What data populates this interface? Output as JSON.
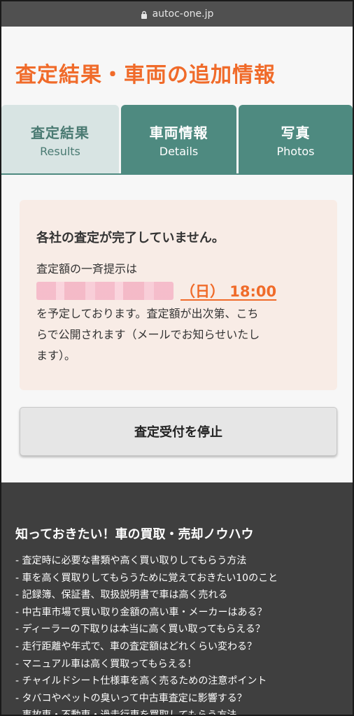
{
  "browser": {
    "url": "autoc-one.jp"
  },
  "page": {
    "title": "査定結果・車両の追加情報"
  },
  "tabs": [
    {
      "jp": "査定結果",
      "en": "Results"
    },
    {
      "jp": "車両情報",
      "en": "Details"
    },
    {
      "jp": "写真",
      "en": "Photos"
    }
  ],
  "notice": {
    "heading": "各社の査定が完了していません。",
    "line1": "査定額の一斉提示は",
    "date_suffix": "（日） 18:00",
    "line2": "を予定しております。査定額が出次第、こち",
    "line3": "らで公開されます（メールでお知らせいたし",
    "line4": "ます）。"
  },
  "stop_button": "査定受付を停止",
  "footer": {
    "title": "知っておきたい！車の買取・売却ノウハウ",
    "links": [
      "- 査定時に必要な書類や高く買い取りしてもらう方法",
      "- 車を高く買取りしてもらうために覚えておきたい10のこと",
      "- 記録簿、保証書、取扱説明書で車は高く売れる",
      "- 中古車市場で買い取り金額の高い車・メーカーはある？",
      "- ディーラーの下取りは本当に高く買い取ってもらえる？",
      "- 走行距離や年式で、車の査定額はどれくらい変わる？",
      "- マニュアル車は高く買取ってもらえる！",
      "- チャイルドシート仕様車を高く売るための注意ポイント",
      "- タバコやペットの臭いって中古車査定に影響する？",
      "- 事故車・不動車・過走行車を買取してもらう方法"
    ]
  },
  "colors": {
    "accent": "#f06b2a",
    "tab_active": "#d8e4e3",
    "tab_inactive": "#4e8a80",
    "footer_bg": "#3f3f3f"
  }
}
